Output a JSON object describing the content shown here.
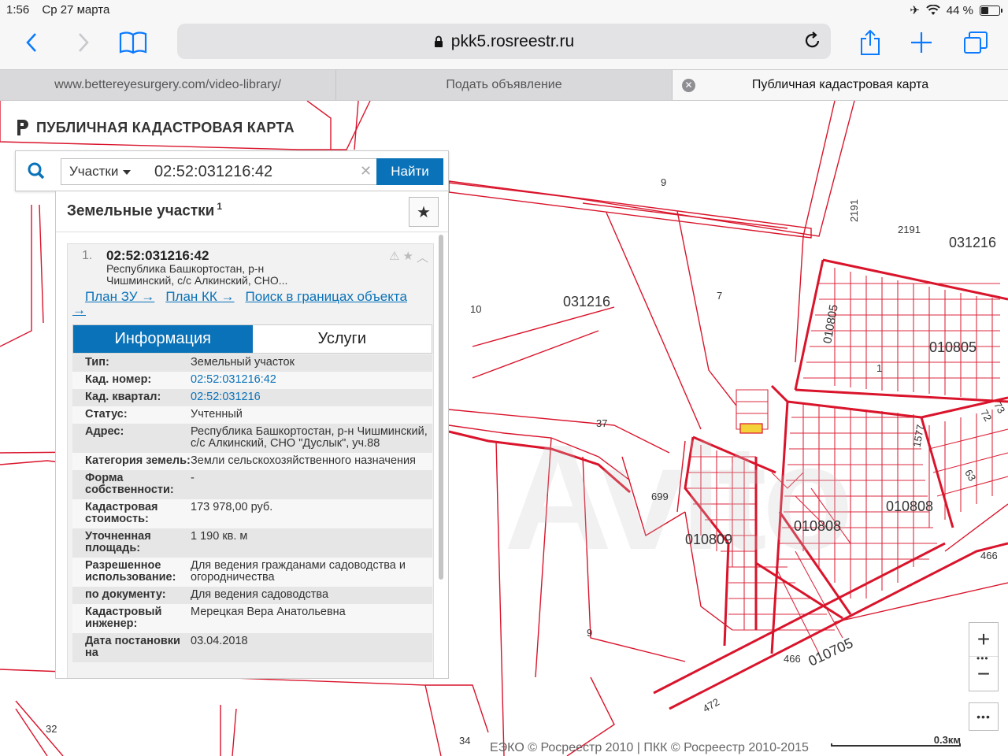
{
  "status_bar": {
    "time": "1:56",
    "date": "Ср 27 марта",
    "battery": "44 %"
  },
  "browser": {
    "url": "pkk5.rosreestr.ru",
    "tabs": [
      {
        "label": "www.bettereyesurgery.com/video-library/"
      },
      {
        "label": "Подать объявление"
      },
      {
        "label": "Публичная кадастровая карта"
      }
    ]
  },
  "app": {
    "title": "ПУБЛИЧНАЯ КАДАСТРОВАЯ КАРТА",
    "search": {
      "type": "Участки",
      "value": "02:52:031216:42",
      "button": "Найти"
    }
  },
  "panel": {
    "title": "Земельные участки",
    "count": "1",
    "result": {
      "num": "1.",
      "id": "02:52:031216:42",
      "address": "Республика Башкортостан, р-н Чишминский, с/с Алкинский, СНО...",
      "links": [
        "План ЗУ →",
        "План КК →",
        "Поиск в границах объекта →"
      ],
      "tabs": [
        "Информация",
        "Услуги"
      ],
      "info": [
        {
          "key": "Тип:",
          "value": "Земельный участок"
        },
        {
          "key": "Кад. номер:",
          "value": "02:52:031216:42"
        },
        {
          "key": "Кад. квартал:",
          "value": "02:52:031216"
        },
        {
          "key": "Статус:",
          "value": "Учтенный"
        },
        {
          "key": "Адрес:",
          "value": "Республика Башкортостан, р-н Чишминский, с/с Алкинский, СНО \"Дуслык\", уч.88"
        },
        {
          "key": "Категория земель:",
          "value": "Земли сельскохозяйственного назначения"
        },
        {
          "key": "Форма собственности:",
          "value": "-"
        },
        {
          "key": "Кадастровая стоимость:",
          "value": "173 978,00 руб."
        },
        {
          "key": "Уточненная площадь:",
          "value": "1 190 кв. м"
        },
        {
          "key": "Разрешенное использование:",
          "value": "Для ведения гражданами садоводства и огородничества"
        },
        {
          "key": "по документу:",
          "value": "Для ведения садоводства"
        },
        {
          "key": "Кадастровый инженер:",
          "value": "Мерецкая Вера Анатольевна"
        },
        {
          "key": "Дата постановки на",
          "value": "03.04.2018"
        }
      ]
    }
  },
  "map": {
    "labels": [
      "9",
      "2191",
      "2191",
      "031216",
      "031216",
      "7",
      "10",
      "010805",
      "010805",
      "1",
      "37",
      "699",
      "010809",
      "010808",
      "010808",
      "466",
      "9",
      "466",
      "010705",
      "472",
      "32",
      "34",
      "72",
      "73",
      "63",
      "1577"
    ],
    "copyright": "ЕЭКО © Росреестр 2010 | ПКК © Росреестр 2010-2015",
    "scale": "0.3км"
  },
  "colors": {
    "accent": "#0a72b8",
    "parcel": "#d9142b"
  }
}
